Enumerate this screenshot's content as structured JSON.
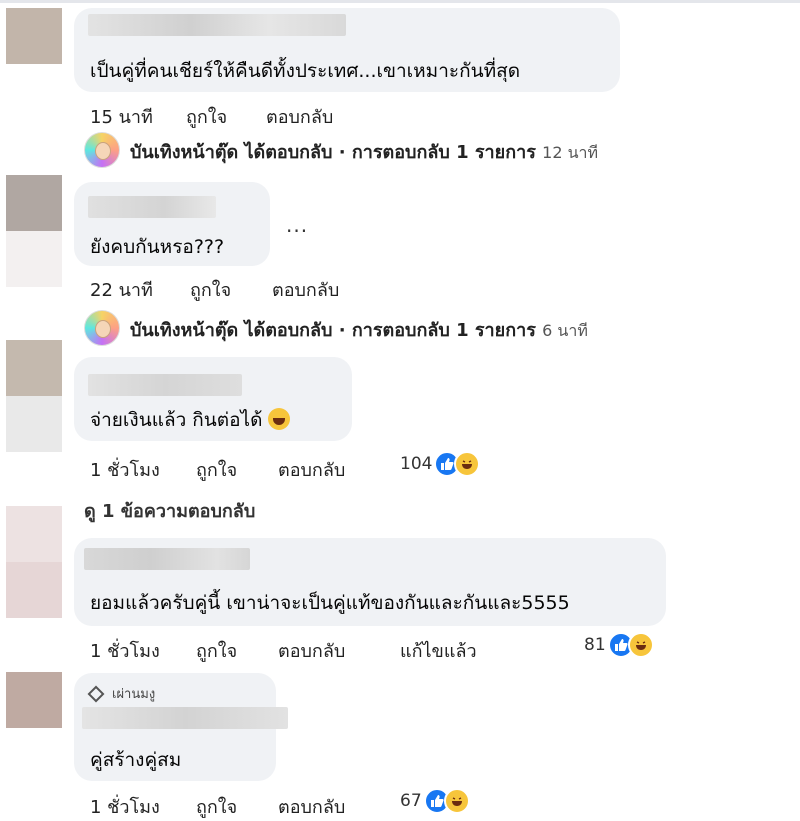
{
  "comments": [
    {
      "text": "เป็นคู่ที่คนเชียร์ให้คืนดีทั้งประเทศ...เขาเหมาะกันที่สุด",
      "time": "15 นาที",
      "like_label": "ถูกใจ",
      "reply_label": "ตอบกลับ",
      "page_reply": {
        "name": "บันเทิงหน้าตุ๊ด ได้ตอบกลับ · การตอบกลับ 1 รายการ",
        "time": "12 นาที"
      }
    },
    {
      "text": "ยังคบกันหรอ???",
      "more": "...",
      "time": "22 นาที",
      "like_label": "ถูกใจ",
      "reply_label": "ตอบกลับ",
      "page_reply": {
        "name": "บันเทิงหน้าตุ๊ด ได้ตอบกลับ · การตอบกลับ 1 รายการ",
        "time": "6 นาที"
      }
    },
    {
      "text": "จ่ายเงินแล้ว กินต่อได้",
      "emoji": "haha-emoji",
      "time": "1 ชั่วโมง",
      "like_label": "ถูกใจ",
      "reply_label": "ตอบกลับ",
      "reactions": {
        "count": "104",
        "icons": [
          "like-icon",
          "haha-icon"
        ]
      },
      "view_replies": "ดู 1 ข้อความตอบกลับ"
    },
    {
      "text": "ยอมแล้วครับคู่นี้ เขาน่าจะเป็นคู่แท้ของกันและกันและ5555",
      "time": "1 ชั่วโมง",
      "like_label": "ถูกใจ",
      "reply_label": "ตอบกลับ",
      "edited": "แก้ไขแล้ว",
      "reactions": {
        "count": "81",
        "icons": [
          "like-icon",
          "haha-icon"
        ]
      }
    },
    {
      "badge": "เผ่านมงู",
      "badge_icon": "diamond-icon",
      "text": "คู่สร้างคู่สม",
      "time": "1 ชั่วโมง",
      "like_label": "ถูกใจ",
      "reply_label": "ตอบกลับ",
      "reactions": {
        "count": "67",
        "icons": [
          "like-icon",
          "haha-icon"
        ]
      }
    }
  ],
  "colors": {
    "bubble": "#f0f2f5",
    "like": "#1877f2",
    "haha": "#f7c53b"
  }
}
